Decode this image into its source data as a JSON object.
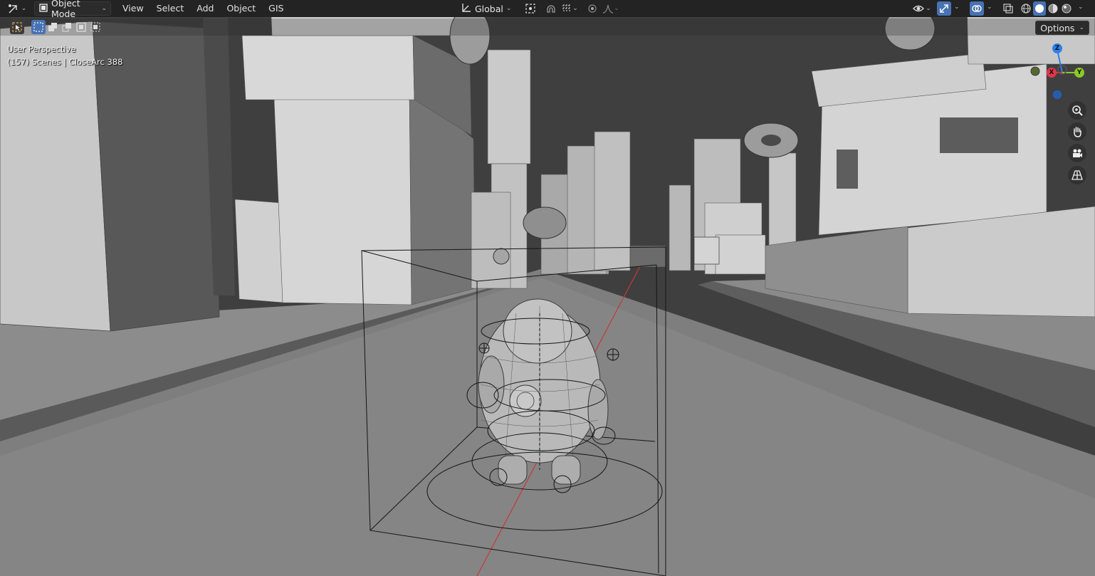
{
  "header": {
    "editor_type_icon": "viewport-editor-icon",
    "mode": {
      "icon": "object-mode-icon",
      "label": "Object Mode"
    },
    "menus": [
      "View",
      "Select",
      "Add",
      "Object",
      "GIS"
    ],
    "transform_orientation": {
      "icon": "orientation-icon",
      "label": "Global"
    },
    "pivot_icon": "pivot-point-icon",
    "snap_icons": [
      "snap-magnet-icon",
      "snap-increment-icon"
    ],
    "proportional_icons": [
      "proportional-edit-icon",
      "falloff-curve-icon"
    ],
    "right_icons": [
      "visibility-eye-icon",
      "gizmo-icon",
      "overlays-icon",
      "xray-icon",
      "wireframe-shading-icon",
      "solid-shading-icon",
      "material-shading-icon",
      "rendered-shading-icon"
    ]
  },
  "toolbar": {
    "select_tool_icon": "select-box-icon",
    "selection_modes": [
      "select-new-icon",
      "select-extend-icon",
      "select-subtract-icon",
      "select-invert-icon",
      "select-intersect-icon"
    ],
    "options_label": "Options"
  },
  "viewport": {
    "perspective_label": "User Perspective",
    "scene_info": "(157) Scenes | CloseArc 388"
  },
  "navigation": {
    "axes": {
      "x": "X",
      "y": "Y",
      "z": "Z"
    },
    "axis_colors": {
      "x": "#e3344c",
      "y": "#8ac926",
      "z": "#2e80e8"
    },
    "buttons": [
      "zoom-icon",
      "pan-hand-icon",
      "camera-icon",
      "perspective-grid-icon"
    ]
  },
  "colors": {
    "header_bg": "#232323",
    "active_blue": "#4772b3",
    "viewport_bg": "#3d3d3d"
  }
}
